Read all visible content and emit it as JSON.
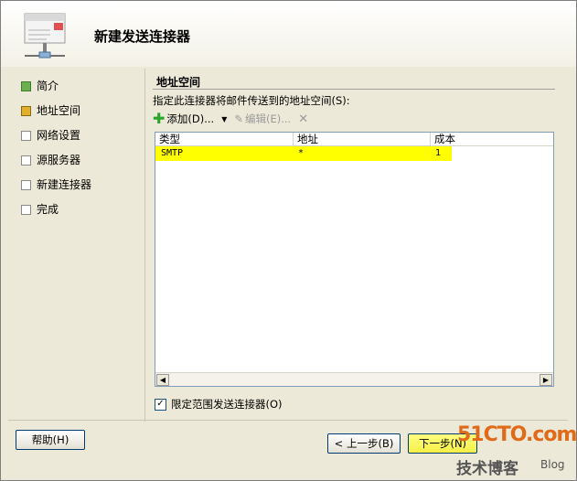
{
  "window": {
    "title": "新建发送连接器"
  },
  "nav": {
    "items": [
      {
        "label": "简介",
        "state": "done"
      },
      {
        "label": "地址空间",
        "state": "active"
      },
      {
        "label": "网络设置",
        "state": "pending"
      },
      {
        "label": "源服务器",
        "state": "pending"
      },
      {
        "label": "新建连接器",
        "state": "pending"
      },
      {
        "label": "完成",
        "state": "pending"
      }
    ]
  },
  "section": {
    "title": "地址空间",
    "description": "指定此连接器将邮件传送到的地址空间(S):"
  },
  "toolbar": {
    "add_label": "添加(D)...",
    "edit_label": "编辑(E)..."
  },
  "table": {
    "columns": [
      "类型",
      "地址",
      "成本"
    ],
    "rows": [
      {
        "type": "SMTP",
        "address": "*",
        "cost": "1"
      }
    ]
  },
  "options": {
    "scope_label": "限定范围发送连接器(O)",
    "scope_checked": true
  },
  "buttons": {
    "help": "帮助(H)",
    "back": "< 上一步(B)",
    "next": "下一步(N)"
  },
  "watermark": {
    "site": "51CTO.com",
    "sub": "技术博客",
    "blog": "Blog"
  }
}
